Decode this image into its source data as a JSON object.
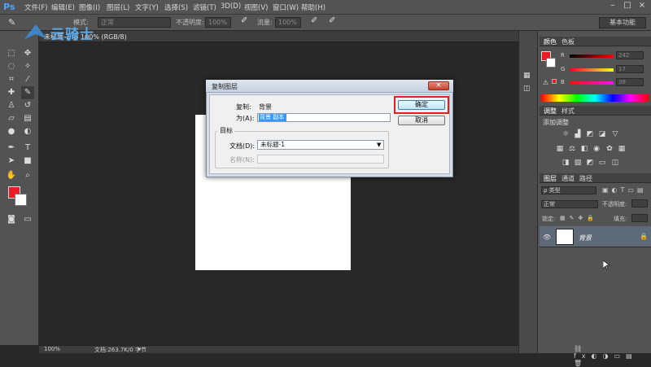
{
  "app": {
    "logo": "Ps",
    "menu": [
      "文件(F)",
      "编辑(E)",
      "图像(I)",
      "图层(L)",
      "文字(Y)",
      "选择(S)",
      "滤镜(T)",
      "3D(D)",
      "视图(V)",
      "窗口(W)",
      "帮助(H)"
    ],
    "window_controls": [
      "–",
      "□",
      "×"
    ]
  },
  "options_bar": {
    "mode_label": "模式:",
    "mode_value": "正常",
    "opacity_label": "不透明度:",
    "opacity_value": "100%",
    "flow_label": "流量:",
    "flow_value": "100%",
    "workspace": "基本功能"
  },
  "document": {
    "tab_label": "未标题-1 @ 100% (RGB/8)",
    "zoom": "100%",
    "doc_info": "文档:263.7K/0 字节"
  },
  "watermark": {
    "text": "云骑士"
  },
  "color_panel": {
    "tabs": [
      "颜色",
      "色板"
    ],
    "r_label": "R",
    "g_label": "G",
    "b_label": "B",
    "r_value": "242",
    "g_value": "17",
    "b_value": "38",
    "foreground_color": "#ed1c24"
  },
  "adjustments_panel": {
    "tabs": [
      "调整",
      "样式"
    ],
    "subtitle": "添加调整"
  },
  "layers_panel": {
    "tabs": [
      "图层",
      "通道",
      "路径"
    ],
    "filter_label": "ρ 类型",
    "blend_mode": "正常",
    "opacity_label": "不透明度:",
    "lock_label": "锁定:",
    "fill_label": "填充:",
    "layer_name": "背景"
  },
  "dialog": {
    "title": "复制图层",
    "copy_label": "复制:",
    "copy_value": "背景",
    "as_label": "为(A):",
    "as_value": "背景 副本",
    "destination_legend": "目标",
    "document_label": "文档(D):",
    "document_value": "未标题-1",
    "name_label": "名称(N):",
    "ok_label": "确定",
    "cancel_label": "取消",
    "close_glyph": "×"
  }
}
